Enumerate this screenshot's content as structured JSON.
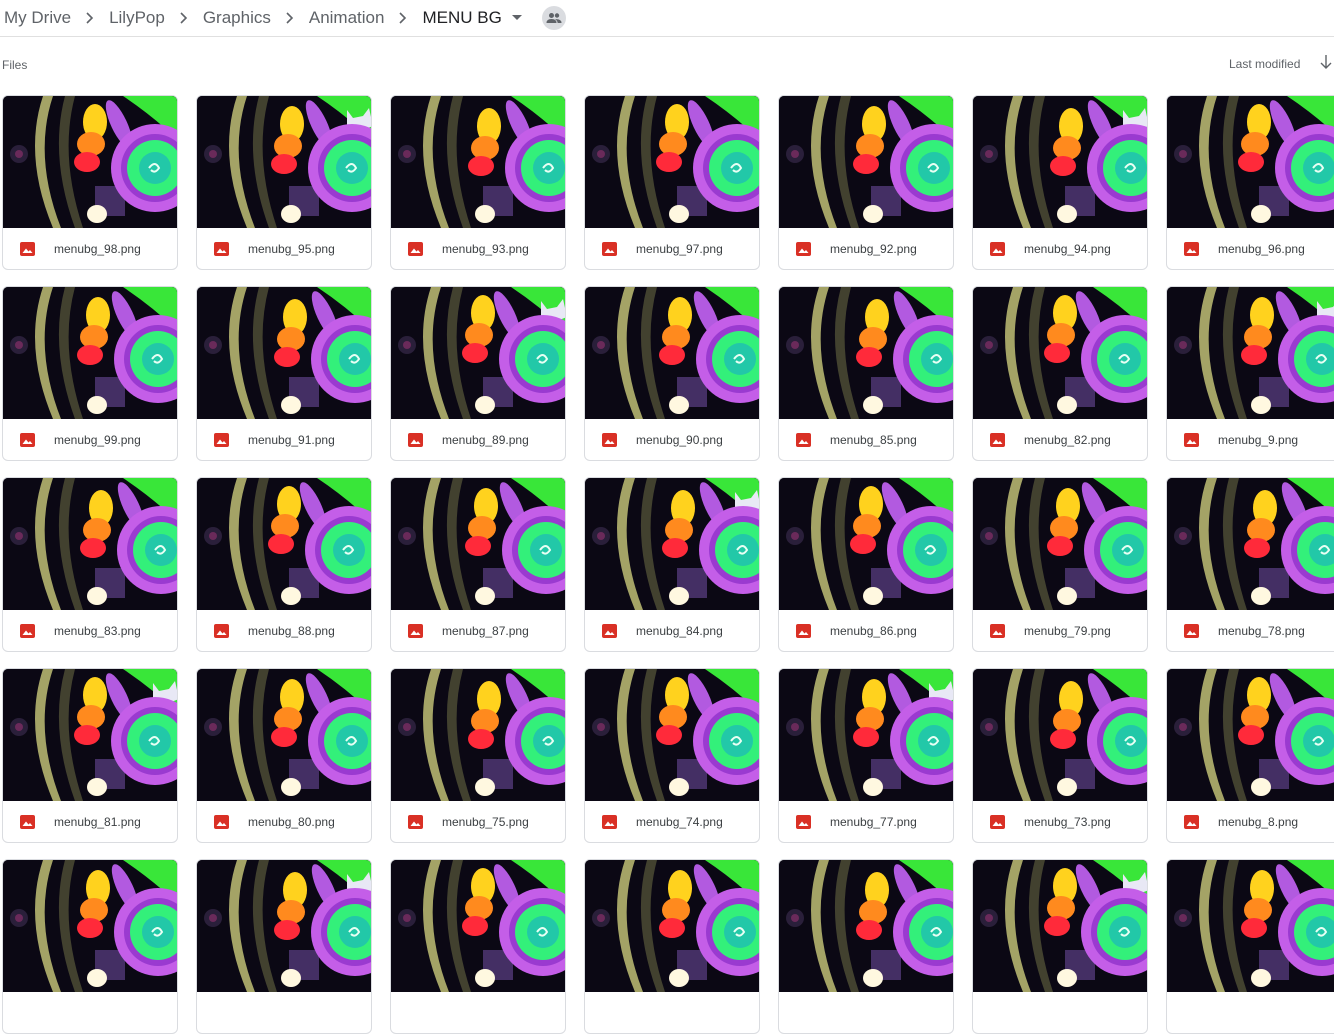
{
  "breadcrumb": [
    "My Drive",
    "LilyPop",
    "Graphics",
    "Animation",
    "MENU BG"
  ],
  "icons": {
    "separator": "chevron-right-icon",
    "dropdown": "arrow-drop-down-icon",
    "shared": "people-icon",
    "sort": "arrow-downward-icon",
    "file": "image-file-icon"
  },
  "section": {
    "title": "Files",
    "sort_label": "Last modified"
  },
  "colors": {
    "image_icon": "#d93025",
    "border": "#dadce0",
    "text_muted": "#5f6368"
  },
  "files": [
    [
      "menubg_98.png",
      "menubg_95.png",
      "menubg_93.png",
      "menubg_97.png",
      "menubg_92.png",
      "menubg_94.png",
      "menubg_96.png"
    ],
    [
      "menubg_99.png",
      "menubg_91.png",
      "menubg_89.png",
      "menubg_90.png",
      "menubg_85.png",
      "menubg_82.png",
      "menubg_9.png"
    ],
    [
      "menubg_83.png",
      "menubg_88.png",
      "menubg_87.png",
      "menubg_84.png",
      "menubg_86.png",
      "menubg_79.png",
      "menubg_78.png"
    ],
    [
      "menubg_81.png",
      "menubg_80.png",
      "menubg_75.png",
      "menubg_74.png",
      "menubg_77.png",
      "menubg_73.png",
      "menubg_8.png"
    ]
  ]
}
